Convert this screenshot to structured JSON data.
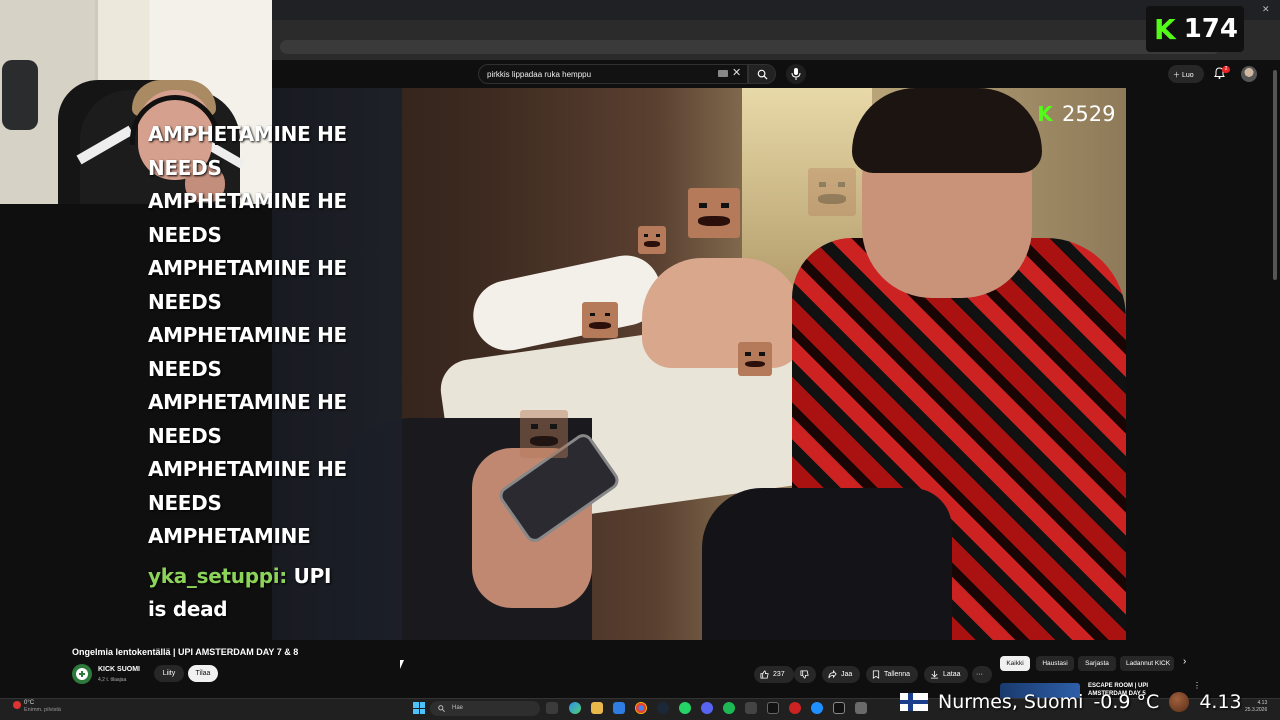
{
  "youtube": {
    "search": {
      "value": "pirkkis lippadaa ruka hemppu"
    },
    "header": {
      "create_label": "Luo",
      "notif_count": "2"
    }
  },
  "stream_overlay": {
    "kick_viewers_top": "174",
    "kick_viewers_video": "2529",
    "kick_color": "#53fc18",
    "chat_lines": [
      "AMPHETAMINE HE",
      "NEEDS",
      "AMPHETAMINE HE",
      "NEEDS",
      "AMPHETAMINE HE",
      "NEEDS",
      "AMPHETAMINE HE",
      "NEEDS",
      "AMPHETAMINE HE",
      "NEEDS",
      "AMPHETAMINE HE",
      "NEEDS",
      "AMPHETAMINE"
    ],
    "chat_message": {
      "user": "yka_setuppi:",
      "text_line1": "UPI",
      "text_line2": "is dead"
    },
    "ticker": {
      "location": "Nurmes, Suomi",
      "temperature": "-0.9 °C",
      "time": "4.13"
    }
  },
  "video": {
    "title": "Ongelmia lentokentällä | UPI AMSTERDAM DAY 7 & 8",
    "channel": {
      "name": "KICK SUOMI",
      "subscribers": "4,2 t. tilaajaa"
    },
    "join_label": "Liity",
    "subscribe_label": "Tilaa",
    "actions": {
      "likes": "237",
      "share": "Jaa",
      "save": "Tallenna",
      "download": "Lataa",
      "more": "···"
    }
  },
  "sidebar": {
    "chips": [
      "Kaikki",
      "Haustasi",
      "Sarjasta",
      "Ladannut KICK"
    ],
    "recommendation": {
      "title": "ESCAPE ROOM | UPI AMSTERDAM DAY 5"
    }
  },
  "taskbar": {
    "weather_temp": "0°C",
    "weather_desc": "Enimm. pilvistä",
    "search_placeholder": "Hae",
    "clock_time": "4.13",
    "clock_date": "25.3.2026"
  },
  "colors": {
    "accent_red": "#ff0000",
    "chat_user": "#8cd35a"
  }
}
